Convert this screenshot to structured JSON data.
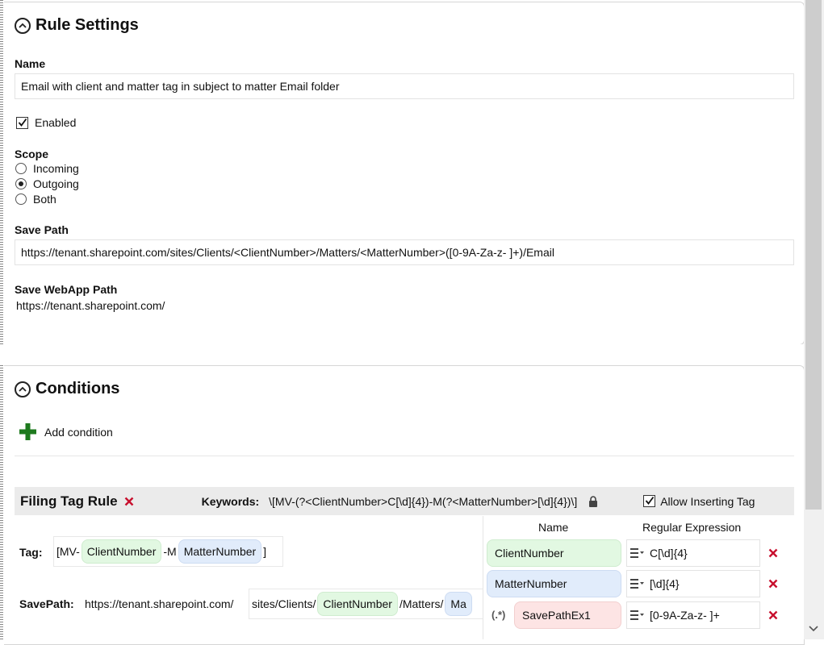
{
  "rule_settings": {
    "title": "Rule Settings",
    "name_label": "Name",
    "name_value": "Email with client and matter tag in subject to matter Email folder",
    "enabled_label": "Enabled",
    "enabled": true,
    "scope_label": "Scope",
    "scope_options": [
      {
        "label": "Incoming",
        "selected": false
      },
      {
        "label": "Outgoing",
        "selected": true
      },
      {
        "label": "Both",
        "selected": false
      }
    ],
    "save_path_label": "Save Path",
    "save_path_value": "https://tenant.sharepoint.com/sites/Clients/<ClientNumber>/Matters/<MatterNumber>([0-9A-Za-z- ]+)/Email",
    "webapp_label": "Save WebApp Path",
    "webapp_value": "https://tenant.sharepoint.com/"
  },
  "conditions": {
    "title": "Conditions",
    "add_label": "Add condition",
    "filing_tag_rule": {
      "title": "Filing Tag Rule",
      "keywords_label": "Keywords:",
      "keywords_value": "\\[MV-(?<ClientNumber>C[\\d]{4})-M(?<MatterNumber>[\\d]{4})\\]",
      "allow_label": "Allow Inserting Tag",
      "allow_checked": true,
      "tag_label": "Tag:",
      "tag_parts": {
        "prefix": "[MV-",
        "client": "ClientNumber",
        "mid": "-M",
        "matter": "MatterNumber",
        "suffix": "]"
      },
      "savepath_label": "SavePath:",
      "savepath_parts": {
        "prefix": "https://tenant.sharepoint.com/",
        "seg1": "sites/Clients/",
        "client": "ClientNumber",
        "seg2": "/Matters/",
        "matter_partial": "Ma"
      },
      "params_headers": {
        "name": "Name",
        "regex": "Regular Expression"
      },
      "params": [
        {
          "name": "ClientNumber",
          "regex": "C[\\d]{4}",
          "color": "#e2f8e2"
        },
        {
          "name": "MatterNumber",
          "regex": "[\\d]{4}",
          "color": "#e1ecfb"
        },
        {
          "name": "SavePathEx1",
          "regex": "[0-9A-Za-z- ]+",
          "color": "#fde4e4",
          "prefix": "(.*)"
        }
      ]
    }
  },
  "colors": {
    "add_icon": "#1e7a1e",
    "delete_icon": "#c8102e"
  }
}
